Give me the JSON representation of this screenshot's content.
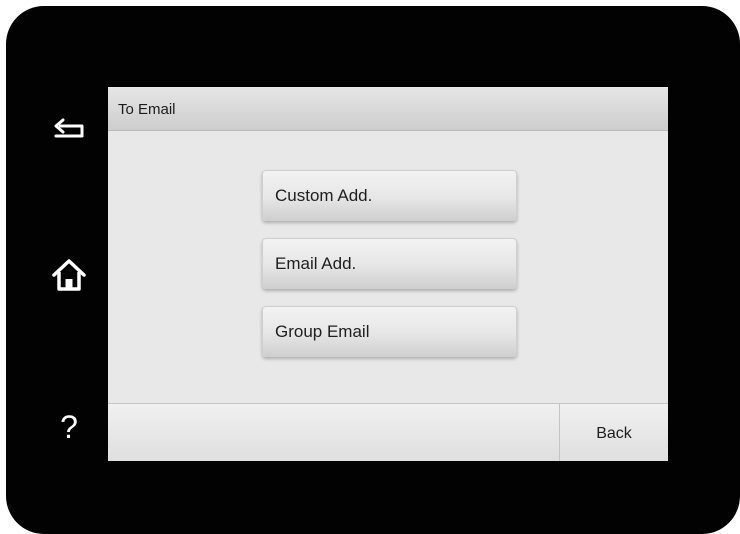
{
  "hardware": {
    "back_icon": "return-arrow-icon",
    "home_icon": "home-icon",
    "help_glyph": "?"
  },
  "screen": {
    "title": "To Email",
    "options": [
      {
        "label": "Custom Add."
      },
      {
        "label": "Email Add."
      },
      {
        "label": "Group Email"
      }
    ],
    "back_label": "Back"
  },
  "colors": {
    "bezel": "#020202",
    "screen_bg": "#e8e8e8",
    "text": "#1e1e1e"
  }
}
